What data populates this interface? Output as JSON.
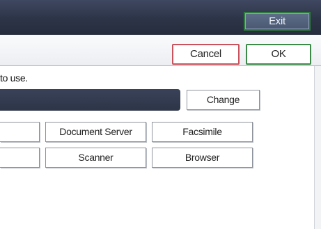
{
  "header": {
    "exit_label": "Exit"
  },
  "actions": {
    "cancel_label": "Cancel",
    "ok_label": "OK"
  },
  "prompt": {
    "text": "to use."
  },
  "selection": {
    "value": "",
    "change_label": "Change"
  },
  "functions": {
    "row1": [
      "",
      "Document Server",
      "Facsimile"
    ],
    "row2": [
      "",
      "Scanner",
      "Browser"
    ]
  },
  "colors": {
    "header_bg": "#2c3447",
    "exit_border": "#2f7d3d",
    "cancel_border": "#c9525c",
    "ok_border": "#3b8a48",
    "selection_bg": "#2d3548"
  }
}
